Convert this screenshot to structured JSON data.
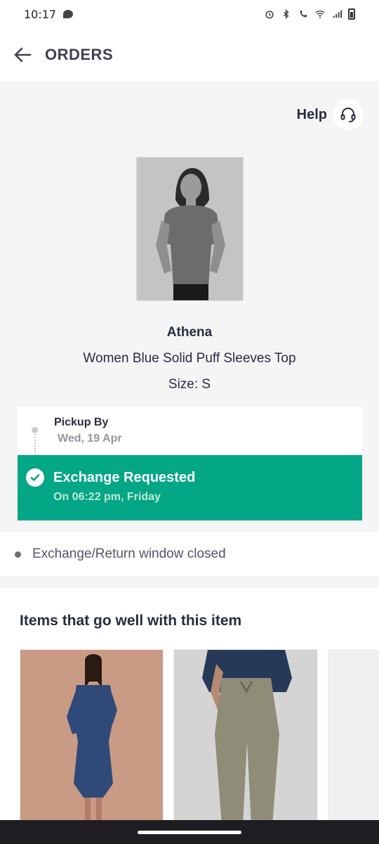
{
  "status_bar": {
    "time": "10:17"
  },
  "header": {
    "title": "ORDERS"
  },
  "help": {
    "label": "Help"
  },
  "product": {
    "brand": "Athena",
    "name": "Women Blue Solid Puff Sleeves Top",
    "size": "Size: S"
  },
  "pickup": {
    "label": "Pickup By",
    "date": "Wed, 19 Apr"
  },
  "exchange": {
    "title": "Exchange Requested",
    "subtitle": "On 06:22 pm, Friday"
  },
  "return_window": {
    "text": "Exchange/Return window closed"
  },
  "recommendations": {
    "title": "Items that go well with this item"
  },
  "colors": {
    "accent_green": "#03a685",
    "text_dark": "#282c3f",
    "muted": "#94969f"
  }
}
